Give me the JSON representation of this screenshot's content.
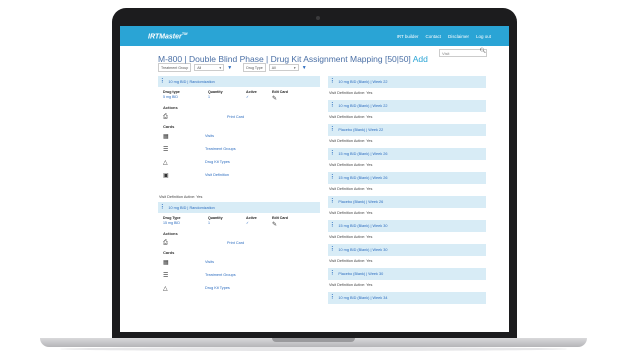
{
  "app": {
    "brand": "IRTMaster",
    "brand_mark": "TM"
  },
  "nav": [
    "IRT builder",
    "Contact",
    "Disclaimer",
    "Log out"
  ],
  "page": {
    "title": "M-800 | Double Blind Phase | Drug Kit Assignment Mapping [50|50]",
    "add_label": "Add"
  },
  "search": {
    "placeholder": "Visit"
  },
  "filters": {
    "treatment_group_label": "Treatment Group",
    "treatment_group_value": "All",
    "drug_type_label": "Drug Type",
    "drug_type_value": "All"
  },
  "left_panels": [
    {
      "header": "10 mg BID | Randomization",
      "drug_type_h": "Drug type",
      "quantity_h": "Quantity",
      "active_h": "Active",
      "edit_h": "Edit Card",
      "drug_type": "5 mg BID",
      "quantity": "1",
      "active": "✓",
      "actions_h": "Actions",
      "print_label": "Print Card",
      "cards_h": "Cards",
      "cards": [
        "Visits",
        "Treatment Groups",
        "Drug Kit Types",
        "Visit Definition"
      ],
      "visit_def": "Visit Definition Active: Yes"
    },
    {
      "header": "10 mg BID | Randomization",
      "drug_type_h": "Drug Type",
      "quantity_h": "Quantity",
      "active_h": "Active",
      "edit_h": "Edit Card",
      "drug_type": "15 mg BID",
      "quantity": "1",
      "active": "✓",
      "actions_h": "Actions",
      "print_label": "Print Card",
      "cards_h": "Cards",
      "cards": [
        "Visits",
        "Treatment Groups",
        "Drug Kit Types"
      ]
    }
  ],
  "right_panels": [
    {
      "header": "10 mg BID (Blank) | Week 22",
      "visit_def": "Visit Definition Active: Yes"
    },
    {
      "header": "10 mg BID (Blank) | Week 22",
      "visit_def": "Visit Definition Active: Yes"
    },
    {
      "header": "Placebo (Blank) | Week 22",
      "visit_def": "Visit Definition Active: Yes"
    },
    {
      "header": "15 mg BID (Blank) | Week 26",
      "visit_def": "Visit Definition Active: Yes"
    },
    {
      "header": "15 mg BID (Blank) | Week 26",
      "visit_def": "Visit Definition Active: Yes"
    },
    {
      "header": "Placebo (Blank) | Week 26",
      "visit_def": "Visit Definition Active: Yes"
    },
    {
      "header": "15 mg BID (Blank) | Week 30",
      "visit_def": "Visit Definition Active: Yes"
    },
    {
      "header": "10 mg BID (Blank) | Week 30",
      "visit_def": "Visit Definition Active: Yes"
    },
    {
      "header": "Placebo (Blank) | Week 30",
      "visit_def": "Visit Definition Active: Yes"
    },
    {
      "header": "10 mg BID (Blank) | Week 34",
      "visit_def": ""
    }
  ],
  "colors": {
    "topbar": "#2aa4d5",
    "panel_header": "#d8ecf6",
    "link": "#2a6bbf"
  },
  "icons": {
    "share": "share-icon",
    "print": "printer-icon",
    "edit": "pencil-icon"
  }
}
